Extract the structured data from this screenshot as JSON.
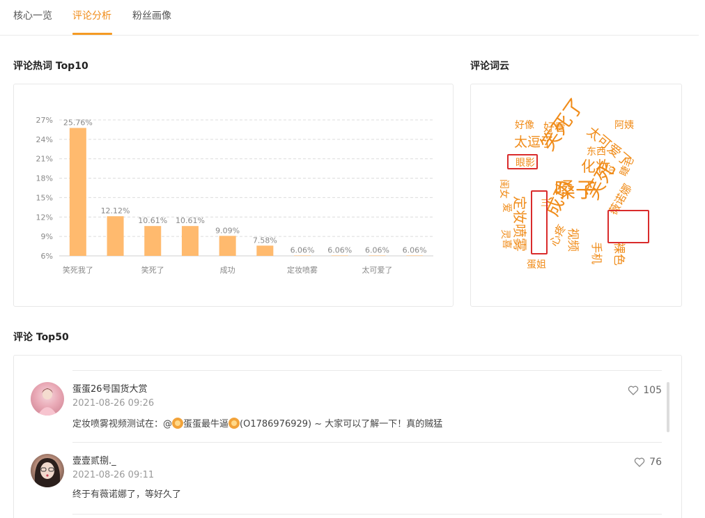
{
  "tabs": [
    {
      "label": "核心一览",
      "active": false
    },
    {
      "label": "评论分析",
      "active": true
    },
    {
      "label": "粉丝画像",
      "active": false
    }
  ],
  "sections": {
    "hot_words_title": "评论热词 Top10",
    "word_cloud_title": "评论词云",
    "comments_title": "评论 Top50"
  },
  "colors": {
    "accent": "#f08c1a",
    "bar": "#ffba6e",
    "highlight_box": "#d92b2b"
  },
  "chart_data": {
    "type": "bar",
    "categories": [
      "笑死我了",
      "",
      "笑死了",
      "",
      "成功",
      "",
      "定妆喷雾",
      "",
      "太可爱了",
      ""
    ],
    "values": [
      25.76,
      12.12,
      10.61,
      10.61,
      9.09,
      7.58,
      6.06,
      6.06,
      6.06,
      6.06
    ],
    "data_labels": [
      "25.76%",
      "12.12%",
      "10.61%",
      "10.61%",
      "9.09%",
      "7.58%",
      "6.06%",
      "6.06%",
      "6.06%",
      "6.06%"
    ],
    "y_ticks": [
      "6%",
      "9%",
      "12%",
      "15%",
      "18%",
      "21%",
      "24%",
      "27%"
    ],
    "ylim": [
      6,
      27
    ],
    "grid": true
  },
  "word_cloud": {
    "words": [
      "好像",
      "好看",
      "阿姨",
      "太可爱了",
      "太逗了",
      "笑死了",
      "东西",
      "化妆",
      "眼影",
      "嗓子",
      "睫毛",
      "LIY",
      "闺女",
      "定妆喷雾",
      "成功",
      "笑死",
      "薇诺娜",
      "视频",
      "爱",
      "灵",
      "三",
      "喜",
      "心疼",
      "手机",
      "裸色",
      "蛋姐"
    ],
    "highlighted": [
      "眼影",
      "定妆喷雾",
      "薇诺娜"
    ]
  },
  "comments": [
    {
      "author": "蛋蛋26号国货大赏",
      "time": "2021-08-26 09:26",
      "text_a": "定妆喷雾视频测试在：@",
      "text_b": "蛋蛋最牛逼",
      "text_c": "(O1786976929) ~ 大家可以了解一下！真的贼猛",
      "likes": "105"
    },
    {
      "author": "壹壹贰捌._",
      "time": "2021-08-26 09:11",
      "text": "终于有薇诺娜了，等好久了",
      "likes": "76"
    }
  ]
}
